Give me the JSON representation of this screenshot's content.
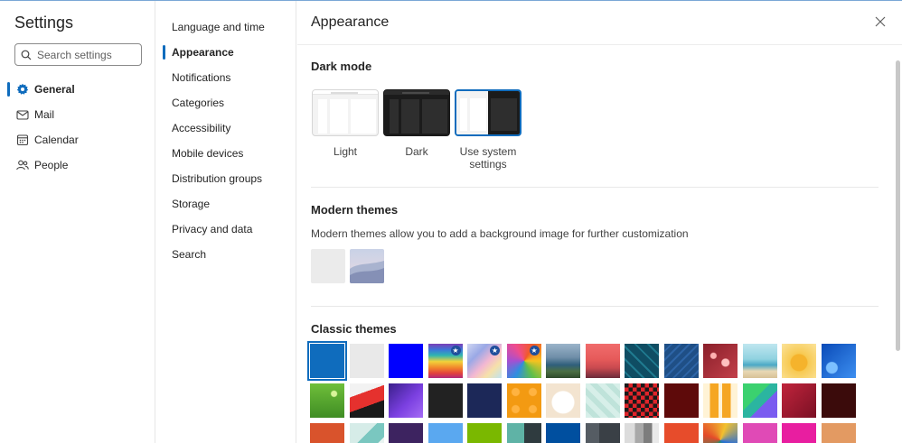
{
  "settings": {
    "title": "Settings",
    "search_placeholder": "Search settings"
  },
  "left_nav": [
    {
      "label": "General",
      "icon": "gear-icon",
      "active": true
    },
    {
      "label": "Mail",
      "icon": "mail-icon",
      "active": false
    },
    {
      "label": "Calendar",
      "icon": "calendar-icon",
      "active": false
    },
    {
      "label": "People",
      "icon": "people-icon",
      "active": false
    }
  ],
  "mid_nav": [
    {
      "label": "Language and time",
      "active": false
    },
    {
      "label": "Appearance",
      "active": true
    },
    {
      "label": "Notifications",
      "active": false
    },
    {
      "label": "Categories",
      "active": false
    },
    {
      "label": "Accessibility",
      "active": false
    },
    {
      "label": "Mobile devices",
      "active": false
    },
    {
      "label": "Distribution groups",
      "active": false
    },
    {
      "label": "Storage",
      "active": false
    },
    {
      "label": "Privacy and data",
      "active": false
    },
    {
      "label": "Search",
      "active": false
    }
  ],
  "panel": {
    "title": "Appearance",
    "dark_mode": {
      "title": "Dark mode",
      "options": [
        {
          "label": "Light",
          "selected": false
        },
        {
          "label": "Dark",
          "selected": false
        },
        {
          "label": "Use system settings",
          "selected": true
        }
      ]
    },
    "modern_themes": {
      "title": "Modern themes",
      "description": "Modern themes allow you to add a background image for further customization",
      "items": [
        "Default",
        "Desert dunes"
      ]
    },
    "classic_themes": {
      "title": "Classic themes",
      "rows": [
        [
          "#0f6cbd",
          "#e9e9e9",
          "#0000ff",
          "rainbow",
          "unicorn",
          "pinwheel",
          "coast",
          "sunset",
          "circuit",
          "blueprint",
          "bokeh",
          "beach",
          "starfish",
          "blue-swirl"
        ],
        [
          "green",
          "red-black",
          "violet",
          "#222222",
          "#1c2858",
          "bricks",
          "cat",
          "zigzag",
          "checkered",
          "#5e0a0a",
          "traffic-cones",
          "cubes",
          "burgundy",
          "#3b0b0b"
        ],
        [
          "#d9532c",
          "teal-geo",
          "#3d2360",
          "#5aa8f0",
          "#7ab800",
          "teal-dark",
          "#004f9f",
          "slate",
          "grey-stripes",
          "#e74c2b",
          "abstract",
          "#e04ab6",
          "#e81ea0",
          "#e39a62"
        ]
      ],
      "selected_index": 0
    }
  },
  "colors": {
    "accent": "#0f6cbd",
    "text": "#242424",
    "divider": "#e8e8e8"
  }
}
